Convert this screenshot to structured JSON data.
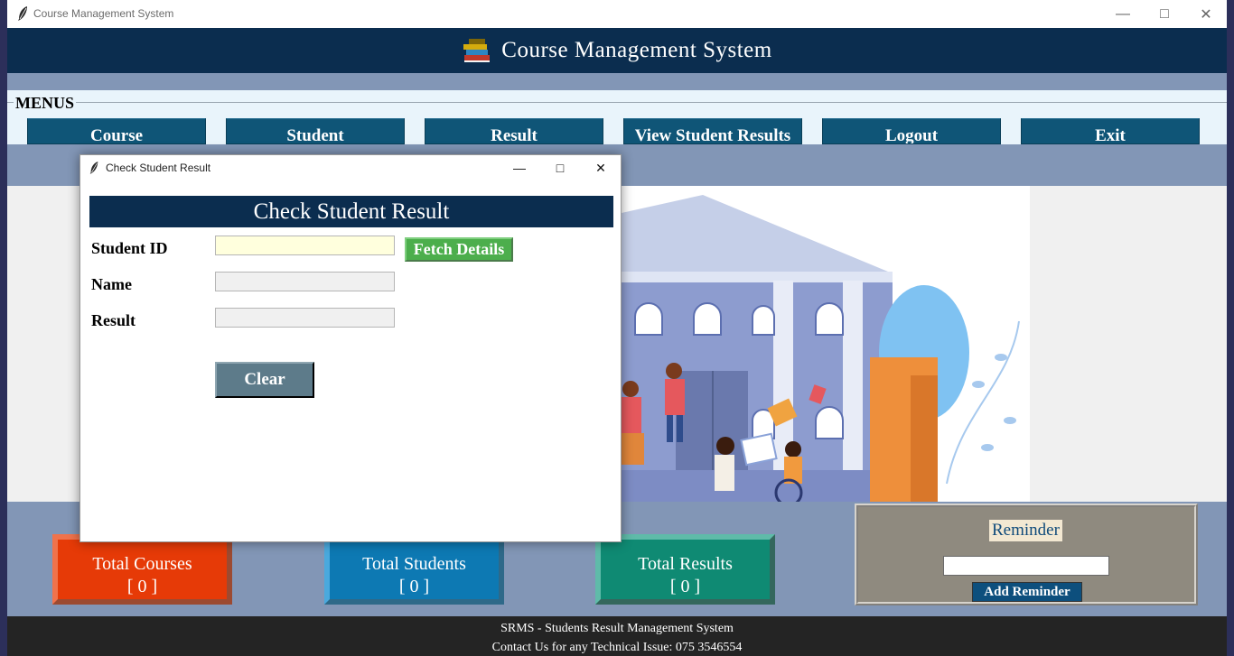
{
  "main_window": {
    "title": "Course Management System",
    "header_title": "Course Management System"
  },
  "menus": {
    "label": "MENUS",
    "items": [
      "Course",
      "Student",
      "Result",
      "View Student Results",
      "Logout",
      "Exit"
    ]
  },
  "stats": {
    "courses": {
      "label": "Total Courses",
      "value": "[ 0 ]"
    },
    "students": {
      "label": "Total Students",
      "value": "[ 0 ]"
    },
    "results": {
      "label": "Total Results",
      "value": "[ 0 ]"
    }
  },
  "reminder": {
    "label": "Reminder",
    "input_value": "",
    "button_label": "Add Reminder"
  },
  "footer": {
    "line1": "SRMS - Students Result Management System",
    "line2": "Contact Us for any Technical Issue: 075 3546554"
  },
  "dialog": {
    "window_title": "Check Student Result",
    "header": "Check Student Result",
    "fields": {
      "student_id": {
        "label": "Student ID",
        "value": ""
      },
      "name": {
        "label": "Name",
        "value": ""
      },
      "result": {
        "label": "Result",
        "value": ""
      }
    },
    "fetch_label": "Fetch Details",
    "clear_label": "Clear"
  },
  "colors": {
    "header_bg": "#0b2d4f",
    "menu_button": "#0f5577",
    "courses_box": "#e63a07",
    "students_box": "#0d79b3",
    "results_box": "#0f8a73",
    "fetch_button": "#4cae4c",
    "clear_button": "#5d7b8a"
  },
  "icons": {
    "app": "feather-icon",
    "header": "books-icon",
    "minimize": "minimize-icon",
    "maximize": "maximize-icon",
    "close": "close-icon"
  }
}
